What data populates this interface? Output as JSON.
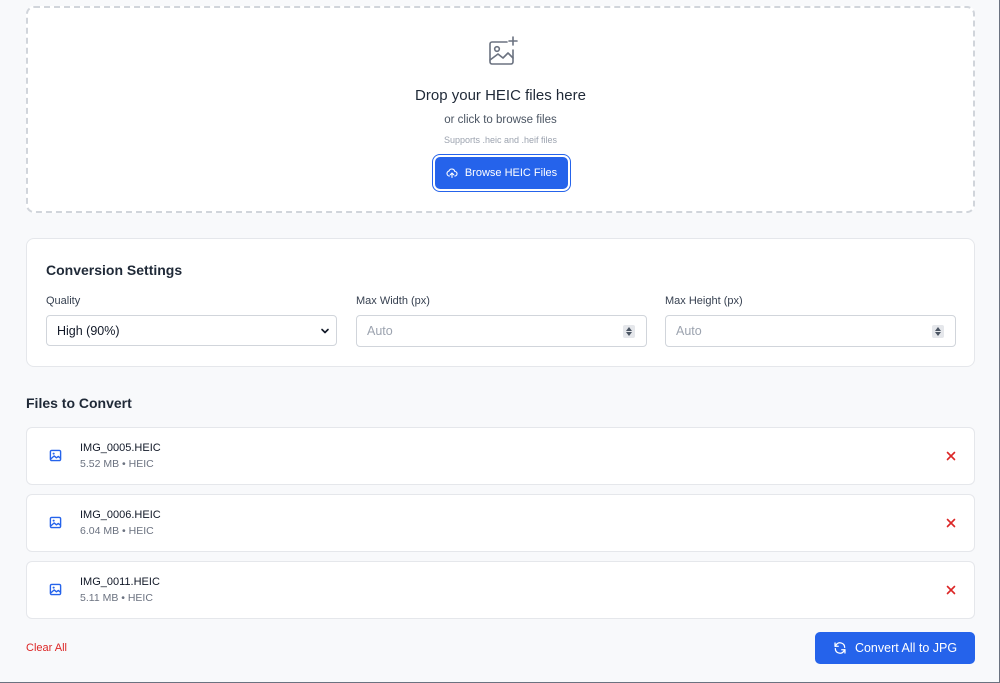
{
  "dropzone": {
    "icon": "image-plus-icon",
    "title": "Drop your HEIC files here",
    "subtitle": "or click to browse files",
    "note": "Supports .heic and .heif files",
    "browse_label": "Browse HEIC Files",
    "browse_icon": "cloud-upload-icon"
  },
  "settings": {
    "title": "Conversion Settings",
    "quality": {
      "label": "Quality",
      "value": "High (90%)"
    },
    "max_width": {
      "label": "Max Width (px)",
      "placeholder": "Auto"
    },
    "max_height": {
      "label": "Max Height (px)",
      "placeholder": "Auto"
    }
  },
  "files": {
    "heading": "Files to Convert",
    "items": [
      {
        "name": "IMG_0005.HEIC",
        "meta": "5.52 MB • HEIC"
      },
      {
        "name": "IMG_0006.HEIC",
        "meta": "6.04 MB • HEIC"
      },
      {
        "name": "IMG_0011.HEIC",
        "meta": "5.11 MB • HEIC"
      }
    ]
  },
  "actions": {
    "clear_all": "Clear All",
    "convert_all": "Convert All to JPG",
    "convert_icon": "refresh-icon"
  },
  "colors": {
    "accent": "#2563eb",
    "danger": "#dc2626",
    "background": "#f8f9fb"
  }
}
